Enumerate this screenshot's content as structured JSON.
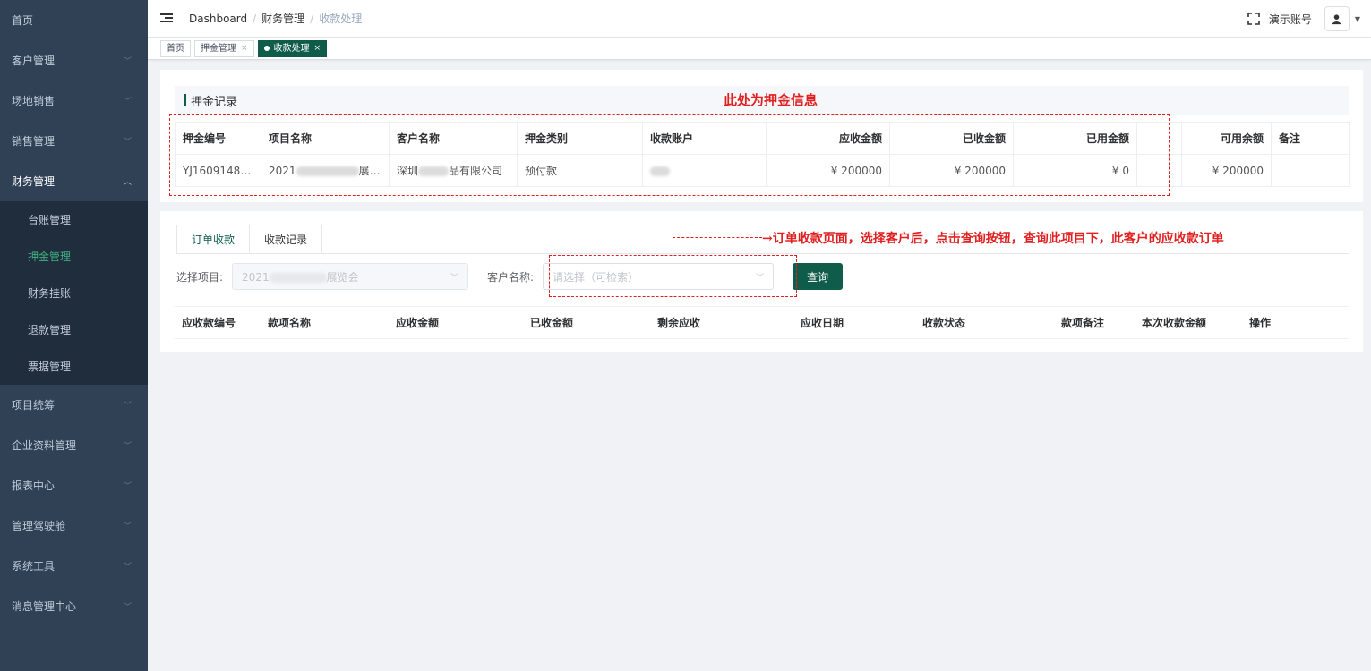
{
  "sidebar": {
    "items": [
      {
        "label": "首页",
        "has_arrow": false
      },
      {
        "label": "客户管理",
        "has_arrow": true
      },
      {
        "label": "场地销售",
        "has_arrow": true
      },
      {
        "label": "销售管理",
        "has_arrow": true
      },
      {
        "label": "财务管理",
        "has_arrow": true,
        "open": true
      },
      {
        "label": "项目统筹",
        "has_arrow": true
      },
      {
        "label": "企业资料管理",
        "has_arrow": true
      },
      {
        "label": "报表中心",
        "has_arrow": true
      },
      {
        "label": "管理驾驶舱",
        "has_arrow": true
      },
      {
        "label": "系统工具",
        "has_arrow": true
      },
      {
        "label": "消息管理中心",
        "has_arrow": true
      }
    ],
    "finance_submenu": [
      "台账管理",
      "押金管理",
      "财务挂账",
      "退款管理",
      "票据管理"
    ],
    "active_sub": "押金管理"
  },
  "navbar": {
    "breadcrumb": [
      "Dashboard",
      "财务管理",
      "收款处理"
    ],
    "separator": "/",
    "account": "演示账号"
  },
  "tags": [
    {
      "label": "首页",
      "closable": false,
      "active": false
    },
    {
      "label": "押金管理",
      "closable": true,
      "active": false
    },
    {
      "label": "收款处理",
      "closable": true,
      "active": true
    }
  ],
  "deposit": {
    "section_title": "押金记录",
    "columns": [
      "押金编号",
      "项目名称",
      "客户名称",
      "押金类别",
      "收款账户",
      "应收金额",
      "已收金额",
      "已用金额",
      "",
      "可用余额",
      "备注"
    ],
    "row": {
      "deposit_no": "YJ16091481...",
      "project_prefix": "2021",
      "project_suffix": "展览会",
      "customer_prefix": "深圳",
      "customer_suffix": "品有限公司",
      "category": "预付款",
      "account": "",
      "receivable": "¥ 200000",
      "received": "¥ 200000",
      "used": "¥ 0",
      "extra": "",
      "available": "¥ 200000",
      "remark": ""
    }
  },
  "orders": {
    "tabs": [
      "订单收款",
      "收款记录"
    ],
    "active_tab": "订单收款",
    "project_label": "选择项目:",
    "project_value_prefix": "2021",
    "project_value_suffix": "展览会",
    "customer_label": "客户名称:",
    "customer_placeholder": "请选择（可检索）",
    "query_label": "查询",
    "columns": [
      "应收款编号",
      "款项名称",
      "应收金额",
      "已收金额",
      "剩余应收",
      "应收日期",
      "收款状态",
      "款项备注",
      "本次收款金额",
      "操作"
    ]
  },
  "annotations": {
    "deposit_note": "此处为押金信息",
    "order_note": "→订单收款页面，选择客户后，点击查询按钮，查询此项目下，此客户的应收款订单",
    "color": "#e02020"
  },
  "colors": {
    "sidebar_bg": "#304156",
    "submenu_bg": "#1f2d3d",
    "brand": "#0f5c4a",
    "active_menu_text": "#3fb27f"
  }
}
